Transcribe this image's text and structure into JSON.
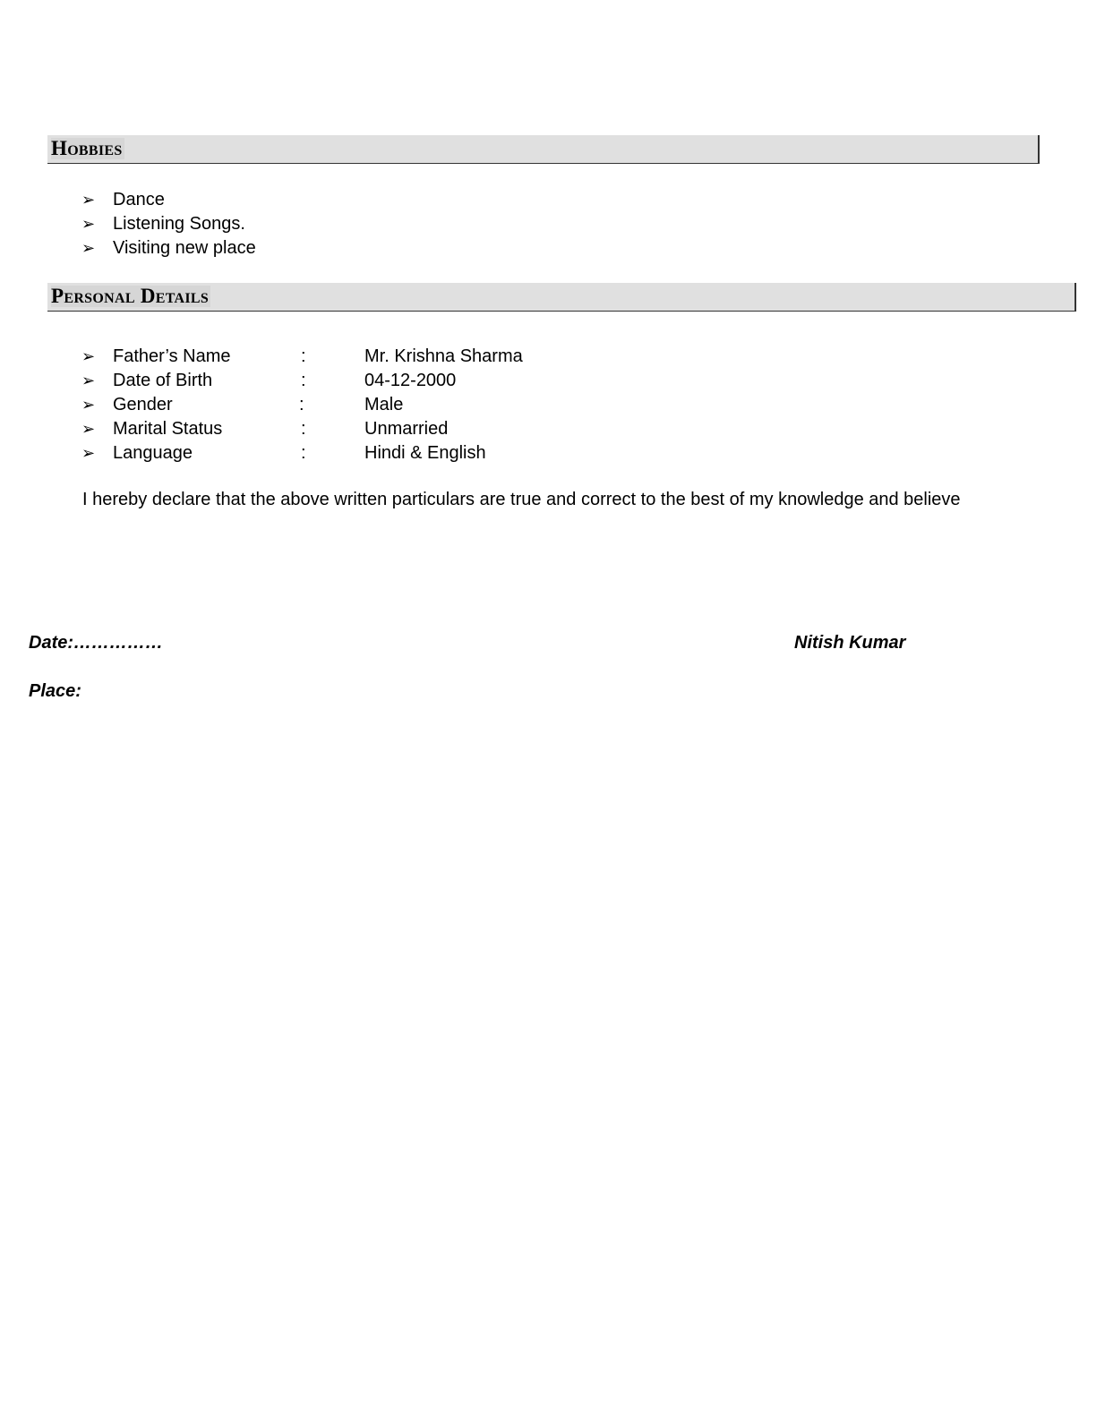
{
  "hobbies": {
    "title": "Hobbies",
    "items": [
      "Dance",
      "Listening Songs.",
      "Visiting new place"
    ]
  },
  "personal_details": {
    "title": "Personal Details",
    "rows": [
      {
        "label": "Father’s Name",
        "colon": ":",
        "value": "Mr. Krishna Sharma"
      },
      {
        "label": "Date of Birth",
        "colon": ":",
        "value": "04-12-2000"
      },
      {
        "label": "Gender",
        "colon": ":",
        "value": "Male"
      },
      {
        "label": "Marital Status",
        "colon": ":",
        "value": "Unmarried"
      },
      {
        "label": "Language",
        "colon": ":",
        "value": "Hindi & English"
      }
    ]
  },
  "declaration": "I hereby declare that the above written particulars are true and correct to the best of my knowledge and believe",
  "footer": {
    "date": "Date:……………",
    "place": "Place:",
    "name": "Nitish Kumar"
  },
  "bullet_glyph": "➢"
}
